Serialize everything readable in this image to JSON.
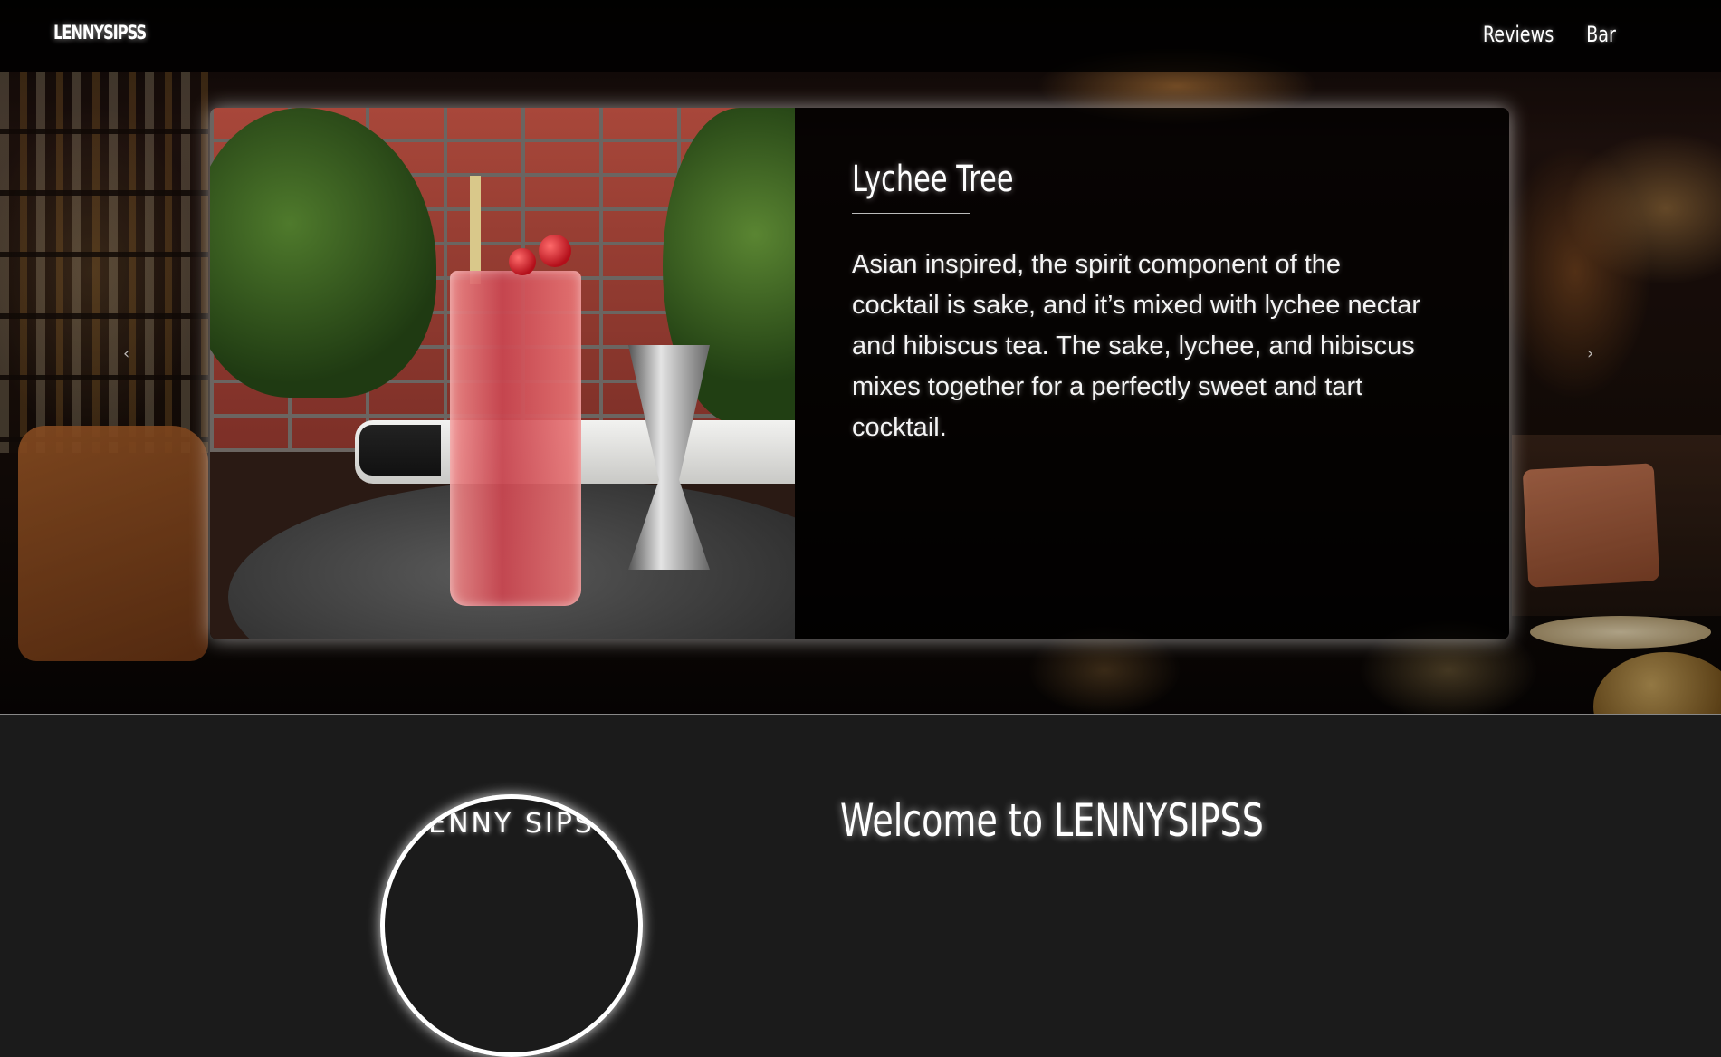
{
  "navbar": {
    "brand": "LENNYSIPSS",
    "links": [
      {
        "label": "Reviews"
      },
      {
        "label": "Bar"
      }
    ]
  },
  "carousel": {
    "prev_icon": "chevron-left-icon",
    "next_icon": "chevron-right-icon",
    "prev_glyph": "‹",
    "next_glyph": "›",
    "slide": {
      "image_alt": "cocktail-photo",
      "title": "Lychee Tree",
      "description": "Asian inspired, the spirit component of the cocktail is sake, and it’s mixed with lychee nectar and hibiscus tea. The sake, lychee, and hibiscus mixes together for a perfectly sweet and tart cocktail."
    }
  },
  "welcome": {
    "logo_text": "ENNY SIPS",
    "title": "Welcome to LENNYSIPSS"
  },
  "colors": {
    "navbar_bg": "#000000",
    "section_bg": "#1b1b1b",
    "text": "#ffffff"
  }
}
